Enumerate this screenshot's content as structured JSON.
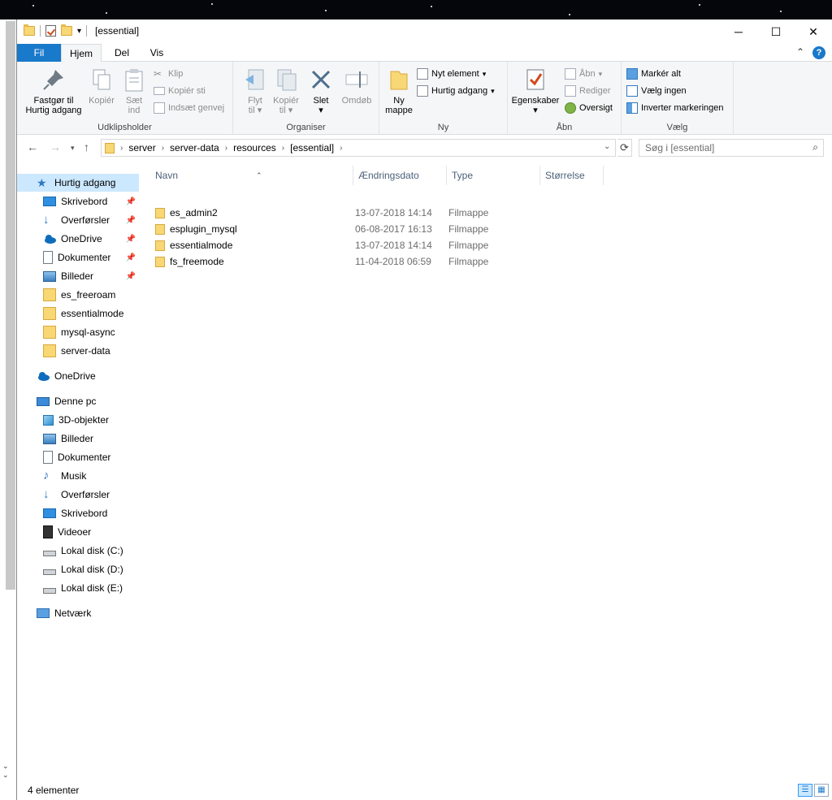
{
  "window": {
    "title": "[essential]"
  },
  "menu": {
    "fil": "Fil",
    "hjem": "Hjem",
    "del": "Del",
    "vis": "Vis"
  },
  "ribbon": {
    "udklip": {
      "label": "Udklipsholder",
      "pin_l1": "Fastgør til",
      "pin_l2": "Hurtig adgang",
      "copy": "Kopiér",
      "paste_l1": "Sæt",
      "paste_l2": "ind",
      "cut": "Klip",
      "copy_path": "Kopiér sti",
      "paste_shortcut": "Indsæt genvej"
    },
    "organiser": {
      "label": "Organiser",
      "move_l1": "Flyt",
      "move_l2": "til",
      "copyto_l1": "Kopiér",
      "copyto_l2": "til",
      "delete": "Slet",
      "rename": "Omdøb"
    },
    "ny": {
      "label": "Ny",
      "folder_l1": "Ny",
      "folder_l2": "mappe",
      "new_item": "Nyt element",
      "easy_access": "Hurtig adgang"
    },
    "aabn": {
      "label": "Åbn",
      "props": "Egenskaber",
      "open": "Åbn",
      "edit": "Rediger",
      "history": "Oversigt"
    },
    "vaelg": {
      "label": "Vælg",
      "all": "Markér alt",
      "none": "Vælg ingen",
      "invert": "Inverter markeringen"
    }
  },
  "address": {
    "crumbs": [
      "server",
      "server-data",
      "resources",
      "[essential]"
    ],
    "search_placeholder": "Søg i [essential]"
  },
  "sidebar": {
    "quick": "Hurtig adgang",
    "quick_items": [
      "Skrivebord",
      "Overførsler",
      "OneDrive",
      "Dokumenter",
      "Billeder",
      "es_freeroam",
      "essentialmode",
      "mysql-async",
      "server-data"
    ],
    "onedrive": "OneDrive",
    "pc": "Denne pc",
    "pc_items": [
      "3D-objekter",
      "Billeder",
      "Dokumenter",
      "Musik",
      "Overførsler",
      "Skrivebord",
      "Videoer",
      "Lokal disk (C:)",
      "Lokal disk (D:)",
      "Lokal disk (E:)"
    ],
    "network": "Netværk"
  },
  "columns": {
    "name": "Navn",
    "date": "Ændringsdato",
    "type": "Type",
    "size": "Størrelse"
  },
  "files": [
    {
      "name": "es_admin2",
      "date": "13-07-2018 14:14",
      "type": "Filmappe"
    },
    {
      "name": "esplugin_mysql",
      "date": "06-08-2017 16:13",
      "type": "Filmappe"
    },
    {
      "name": "essentialmode",
      "date": "13-07-2018 14:14",
      "type": "Filmappe"
    },
    {
      "name": "fs_freemode",
      "date": "11-04-2018 06:59",
      "type": "Filmappe"
    }
  ],
  "status": {
    "count": "4 elementer"
  },
  "colors": {
    "accent": "#1979ca",
    "selection": "#cce8ff",
    "folder": "#f8d775"
  }
}
